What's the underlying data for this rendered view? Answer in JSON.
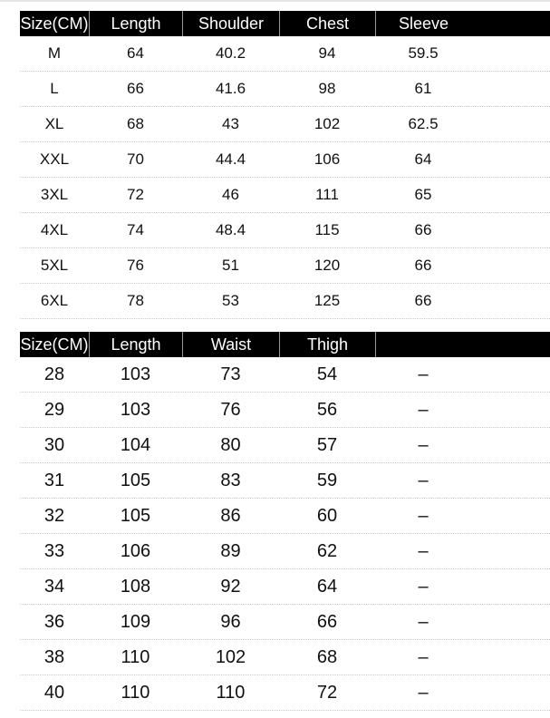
{
  "top_table": {
    "headers": [
      "Size(CM)",
      "Length",
      "Shoulder",
      "Chest",
      "Sleeve"
    ],
    "rows": [
      [
        "M",
        "64",
        "40.2",
        "94",
        "59.5"
      ],
      [
        "L",
        "66",
        "41.6",
        "98",
        "61"
      ],
      [
        "XL",
        "68",
        "43",
        "102",
        "62.5"
      ],
      [
        "XXL",
        "70",
        "44.4",
        "106",
        "64"
      ],
      [
        "3XL",
        "72",
        "46",
        "111",
        "65"
      ],
      [
        "4XL",
        "74",
        "48.4",
        "115",
        "66"
      ],
      [
        "5XL",
        "76",
        "51",
        "120",
        "66"
      ],
      [
        "6XL",
        "78",
        "53",
        "125",
        "66"
      ]
    ]
  },
  "bottom_table": {
    "headers": [
      "Size(CM)",
      "Length",
      "Waist",
      "Thigh",
      ""
    ],
    "rows": [
      [
        "28",
        "103",
        "73",
        "54",
        "–"
      ],
      [
        "29",
        "103",
        "76",
        "56",
        "–"
      ],
      [
        "30",
        "104",
        "80",
        "57",
        "–"
      ],
      [
        "31",
        "105",
        "83",
        "59",
        "–"
      ],
      [
        "32",
        "105",
        "86",
        "60",
        "–"
      ],
      [
        "33",
        "106",
        "89",
        "62",
        "–"
      ],
      [
        "34",
        "108",
        "92",
        "64",
        "–"
      ],
      [
        "36",
        "109",
        "96",
        "66",
        "–"
      ],
      [
        "38",
        "110",
        "102",
        "68",
        "–"
      ],
      [
        "40",
        "110",
        "110",
        "72",
        "–"
      ]
    ]
  }
}
